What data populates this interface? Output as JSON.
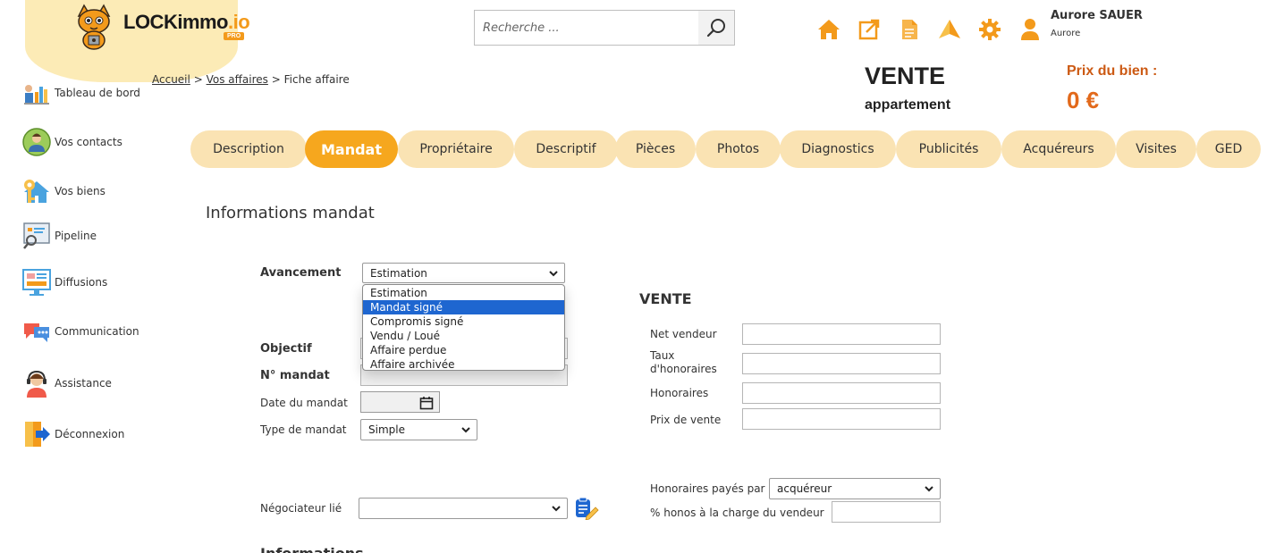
{
  "header": {
    "logo_text": "LOCKimmo",
    "logo_suffix": ".io",
    "logo_badge": "PRO",
    "search_placeholder": "Recherche ...",
    "user_name": "Aurore SAUER",
    "user_subtitle": "Aurore",
    "icons": [
      "home-icon",
      "external-link-icon",
      "document-icon",
      "send-icon",
      "gear-icon",
      "user-icon"
    ],
    "accent_color": "#f39a1b"
  },
  "sidebar": {
    "items": [
      {
        "label": "Tableau de bord",
        "icon": "dashboard-icon"
      },
      {
        "label": "Vos contacts",
        "icon": "contacts-icon"
      },
      {
        "label": "Vos biens",
        "icon": "properties-icon"
      },
      {
        "label": "Pipeline",
        "icon": "pipeline-icon"
      },
      {
        "label": "Diffusions",
        "icon": "diffusions-icon"
      },
      {
        "label": "Communication",
        "icon": "communication-icon"
      },
      {
        "label": "Assistance",
        "icon": "assistance-icon"
      },
      {
        "label": "Déconnexion",
        "icon": "logout-icon"
      }
    ]
  },
  "breadcrumb": {
    "home": "Accueil",
    "sep": ">",
    "affairs": "Vos affaires",
    "current": "Fiche affaire"
  },
  "summary": {
    "type": "VENTE",
    "property": "appartement",
    "price_label": "Prix du bien :",
    "price_value": "0 €"
  },
  "tabs": [
    {
      "label": "Description",
      "active": false
    },
    {
      "label": "Mandat",
      "active": true
    },
    {
      "label": "Propriétaire",
      "active": false
    },
    {
      "label": "Descriptif",
      "active": false
    },
    {
      "label": "Pièces",
      "active": false
    },
    {
      "label": "Photos",
      "active": false
    },
    {
      "label": "Diagnostics",
      "active": false
    },
    {
      "label": "Publicités",
      "active": false
    },
    {
      "label": "Acquéreurs",
      "active": false
    },
    {
      "label": "Visites",
      "active": false
    },
    {
      "label": "GED",
      "active": false
    }
  ],
  "mandat": {
    "section_title": "Informations mandat",
    "avancement_label": "Avancement",
    "avancement_value": "Estimation",
    "avancement_options": [
      "Estimation",
      "Mandat signé",
      "Compromis signé",
      "Vendu / Loué",
      "Affaire perdue",
      "Affaire archivée"
    ],
    "avancement_highlighted": "Mandat signé",
    "objectif_label": "Objectif",
    "numero_label": "N° mandat",
    "date_label": "Date du mandat",
    "type_label": "Type de mandat",
    "type_value": "Simple",
    "negociateur_label": "Négociateur lié",
    "negociateur_value": "",
    "next_section_partial": "Informations"
  },
  "vente": {
    "title": "VENTE",
    "net_vendeur_label": "Net vendeur",
    "taux_label_line1": "Taux",
    "taux_label_line2": "d'honoraires",
    "honoraires_label": "Honoraires",
    "prix_vente_label": "Prix de vente",
    "payes_par_label": "Honoraires payés par",
    "payes_par_value": "acquéreur",
    "honos_vendeur_label": "% honos à la charge du vendeur"
  }
}
